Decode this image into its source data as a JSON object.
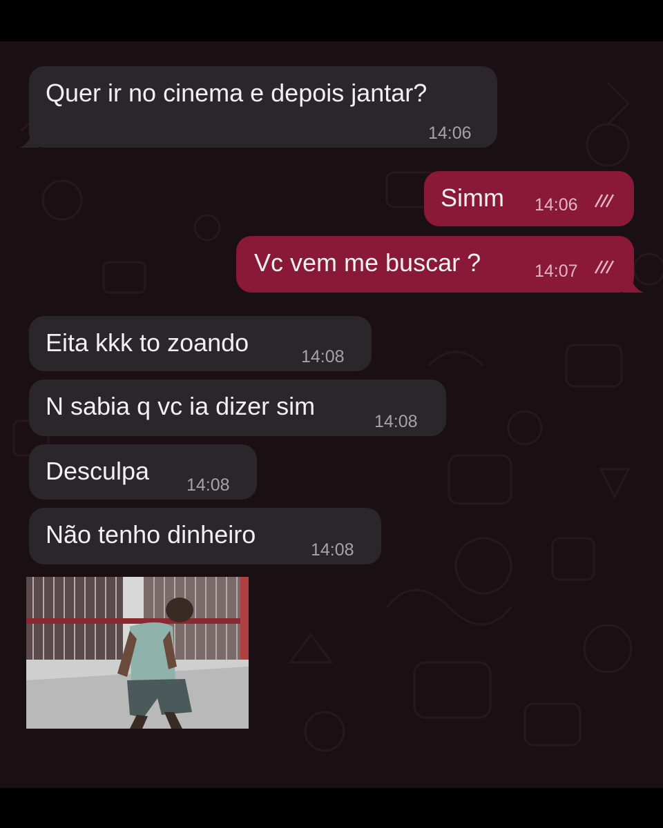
{
  "colors": {
    "chat_background": "#1a0f13",
    "incoming_bubble": "#2a2629",
    "outgoing_bubble": "#8a1838",
    "text": "#f1f1f1"
  },
  "messages": [
    {
      "direction": "incoming",
      "text": "Quer ir no cinema e depois jantar?",
      "time": "14:06"
    },
    {
      "direction": "outgoing",
      "text": "Simm",
      "time": "14:06",
      "status": "double-check-icon"
    },
    {
      "direction": "outgoing",
      "text": "Vc vem me buscar ?",
      "time": "14:07",
      "status": "double-check-icon"
    },
    {
      "direction": "incoming",
      "text": "Eita kkk to zoando",
      "time": "14:08"
    },
    {
      "direction": "incoming",
      "text": "N sabia q vc ia dizer sim",
      "time": "14:08"
    },
    {
      "direction": "incoming",
      "text": "Desculpa",
      "time": "14:08"
    },
    {
      "direction": "incoming",
      "text": "Não tenho dinheiro",
      "time": "14:08"
    }
  ],
  "media": {
    "type": "video-thumbnail",
    "subject": "man-walking-on-street"
  }
}
